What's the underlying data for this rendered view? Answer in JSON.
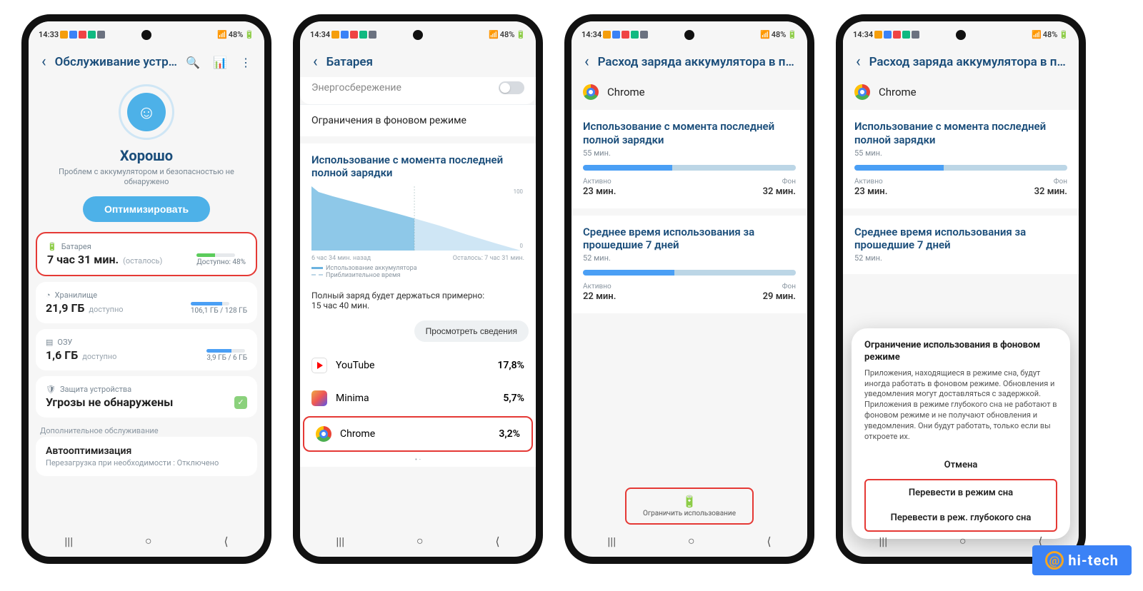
{
  "status": {
    "time1": "14:33",
    "time2": "14:34",
    "battery_pct": "48%"
  },
  "phone1": {
    "title": "Обслуживание устро…",
    "hero_title": "Хорошо",
    "hero_sub": "Проблем с аккумулятором и безопасностью не обнаружено",
    "optimize": "Оптимизировать",
    "battery_label": "Батарея",
    "battery_main": "7 час 31 мин.",
    "battery_sub": "(осталось)",
    "battery_right": "Доступно: 48%",
    "storage_label": "Хранилище",
    "storage_main": "21,9 ГБ",
    "storage_sub": "доступно",
    "storage_right": "106,1 ГБ / 128 ГБ",
    "ram_label": "ОЗУ",
    "ram_main": "1,6 ГБ",
    "ram_sub": "доступно",
    "ram_right": "3,9 ГБ / 6 ГБ",
    "protect_label": "Защита устройства",
    "protect_main": "Угрозы не обнаружены",
    "extra_label": "Дополнительное обслуживание",
    "auto_title": "Автооптимизация",
    "auto_sub": "Перезагрузка при необходимости : Отключено"
  },
  "phone2": {
    "title": "Батарея",
    "item_powersave": "Энергосбережение",
    "item_bg": "Ограничения в фоновом режиме",
    "usage_title": "Использование с момента последней полной зарядки",
    "chart_left": "6 час 34 мин. назад",
    "chart_right": "Осталось: 7 час 31 мин.",
    "legend_solid": "Использование аккумулятора",
    "legend_dash": "Приблизительное время",
    "fullcharge_pre": "Полный заряд будет держаться примерно:",
    "fullcharge_val": "15 час 40 мин.",
    "view_details": "Просмотреть сведения",
    "apps": [
      {
        "name": "YouTube",
        "pct": "17,8%"
      },
      {
        "name": "Minima",
        "pct": "5,7%"
      },
      {
        "name": "Chrome",
        "pct": "3,2%"
      }
    ]
  },
  "chart_data": {
    "type": "area",
    "title": "Использование с момента последней полной зарядки",
    "xlabel": "",
    "ylabel": "%",
    "ylim": [
      0,
      100
    ],
    "series": [
      {
        "name": "Использование аккумулятора",
        "x": [
          0,
          1,
          2,
          3,
          4,
          5,
          6,
          7
        ],
        "values": [
          100,
          90,
          82,
          74,
          66,
          60,
          54,
          48
        ]
      },
      {
        "name": "Приблизительное время",
        "x": [
          7,
          8,
          9,
          10,
          11,
          12,
          13,
          14
        ],
        "values": [
          48,
          42,
          35,
          28,
          21,
          14,
          7,
          0
        ]
      }
    ],
    "x_left_label": "6 час 34 мин. назад",
    "x_right_label": "Осталось: 7 час 31 мин."
  },
  "phone3": {
    "title": "Расход заряда аккумулятора в пр…",
    "app": "Chrome",
    "since_title": "Использование с момента последней полной зарядки",
    "since_min": "55 мин.",
    "active_lbl": "Активно",
    "active_val": "23 мин.",
    "bg_lbl": "Фон",
    "bg_val": "32 мин.",
    "avg_title": "Среднее время использования за прошедшие 7 дней",
    "avg_min": "52 мин.",
    "avg_active": "22 мин.",
    "avg_bg": "29 мин.",
    "restrict": "Ограничить использование"
  },
  "phone4": {
    "title": "Расход заряда аккумулятора в пр…",
    "dialog_title": "Ограничение использования в фоновом режиме",
    "dialog_body": "Приложения, находящиеся в режиме сна, будут иногда работать в фоновом режиме. Обновления и уведомления могут доставляться с задержкой. Приложения в режиме глубокого сна не работают в фоновом режиме и не получают обновления и уведомления. Они будут работать, только если вы откроете их.",
    "cancel": "Отмена",
    "sleep": "Перевести в режим сна",
    "deep_sleep": "Перевести в реж. глубокого сна"
  },
  "watermark": "hi-tech"
}
